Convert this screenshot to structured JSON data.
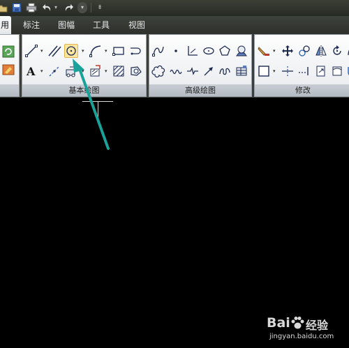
{
  "tabs": {
    "active_partial": "用",
    "annotate": "标注",
    "layout": "图幅",
    "tools": "工具",
    "view": "视图"
  },
  "panels": {
    "basic_draw": "基本绘图",
    "advanced_draw": "高级绘图",
    "modify": "修改"
  },
  "toolbar_icons": [
    "new-icon",
    "save-icon",
    "print-icon",
    "undo-icon",
    "redo-icon",
    "customize-dropdown-icon"
  ],
  "highlight_color": "#fbe6a1",
  "arrow_color": "#1aa29a",
  "watermark": {
    "brand": "Bai",
    "brand2": "经验",
    "url": "jingyan.baidu.com"
  }
}
